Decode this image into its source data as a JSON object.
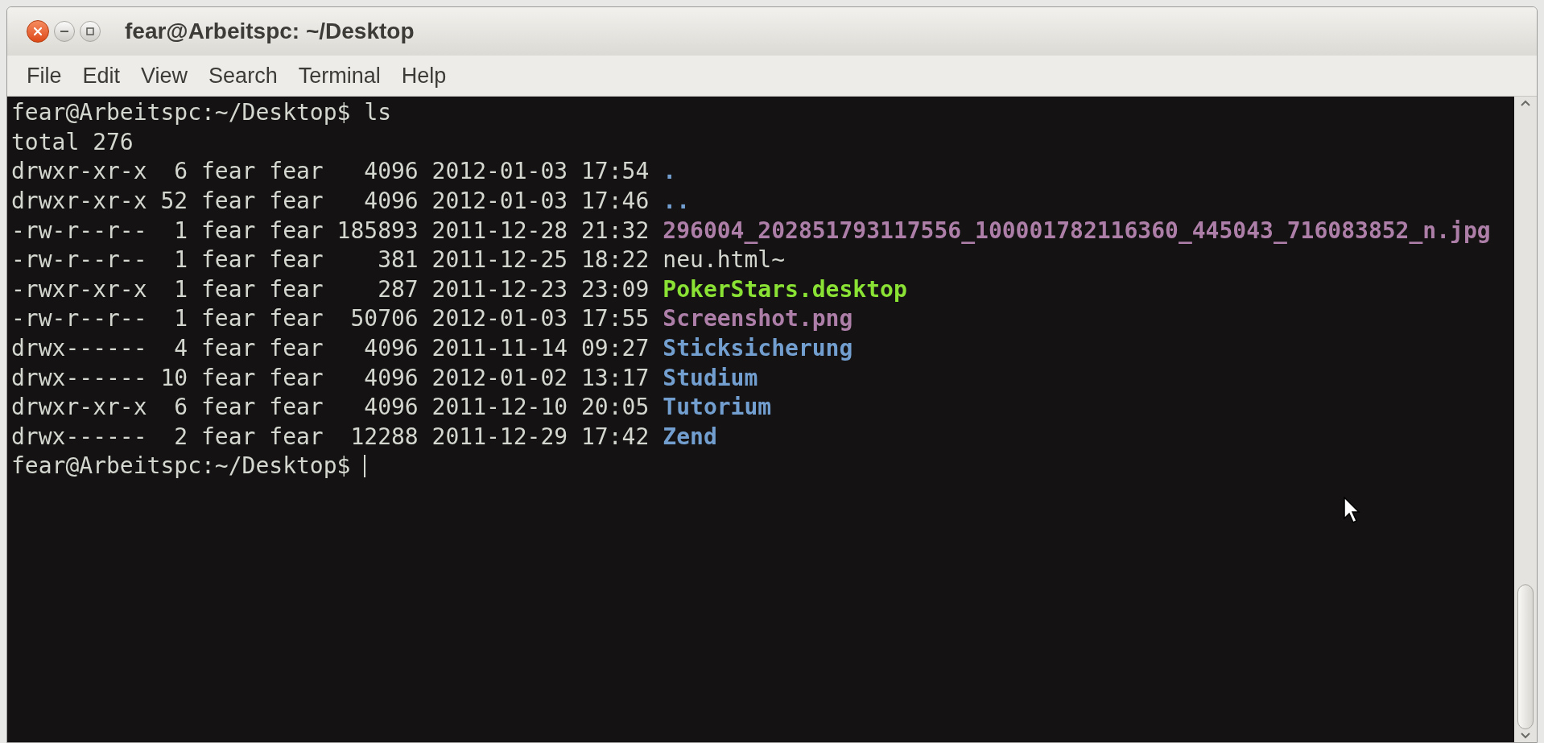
{
  "window": {
    "title": "fear@Arbeitspc: ~/Desktop"
  },
  "menu": [
    "File",
    "Edit",
    "View",
    "Search",
    "Terminal",
    "Help"
  ],
  "terminal": {
    "lines": [
      {
        "kind": "prompt",
        "prompt": "fear@Arbeitspc:~/Desktop$",
        "command": "ls"
      },
      {
        "kind": "plain",
        "text": "total 276"
      },
      {
        "kind": "entry",
        "details": "drwxr-xr-x  6 fear fear   4096 2012-01-03 17:54",
        "name": ".",
        "color": "#729fcf",
        "bold": true
      },
      {
        "kind": "entry",
        "details": "drwxr-xr-x 52 fear fear   4096 2012-01-03 17:46",
        "name": "..",
        "color": "#729fcf",
        "bold": true
      },
      {
        "kind": "entry",
        "details": "-rw-r--r--  1 fear fear 185893 2011-12-28 21:32",
        "name": "296004_202851793117556_100001782116360_445043_716083852_n.jpg",
        "color": "#ad7fa8",
        "bold": true
      },
      {
        "kind": "entry",
        "details": "-rw-r--r--  1 fear fear    381 2011-12-25 18:22",
        "name": "neu.html~",
        "color": "#d3d7cf",
        "bold": false
      },
      {
        "kind": "entry",
        "details": "-rwxr-xr-x  1 fear fear    287 2011-12-23 23:09",
        "name": "PokerStars.desktop",
        "color": "#8ae234",
        "bold": true
      },
      {
        "kind": "entry",
        "details": "-rw-r--r--  1 fear fear  50706 2012-01-03 17:55",
        "name": "Screenshot.png",
        "color": "#ad7fa8",
        "bold": true
      },
      {
        "kind": "entry",
        "details": "drwx------  4 fear fear   4096 2011-11-14 09:27",
        "name": "Sticksicherung",
        "color": "#729fcf",
        "bold": true
      },
      {
        "kind": "entry",
        "details": "drwx------ 10 fear fear   4096 2012-01-02 13:17",
        "name": "Studium",
        "color": "#729fcf",
        "bold": true
      },
      {
        "kind": "entry",
        "details": "drwxr-xr-x  6 fear fear   4096 2011-12-10 20:05",
        "name": "Tutorium",
        "color": "#729fcf",
        "bold": true
      },
      {
        "kind": "entry",
        "details": "drwx------  2 fear fear  12288 2011-12-29 17:42",
        "name": "Zend",
        "color": "#729fcf",
        "bold": true
      },
      {
        "kind": "prompt",
        "prompt": "fear@Arbeitspc:~/Desktop$",
        "cursor": true
      }
    ]
  }
}
